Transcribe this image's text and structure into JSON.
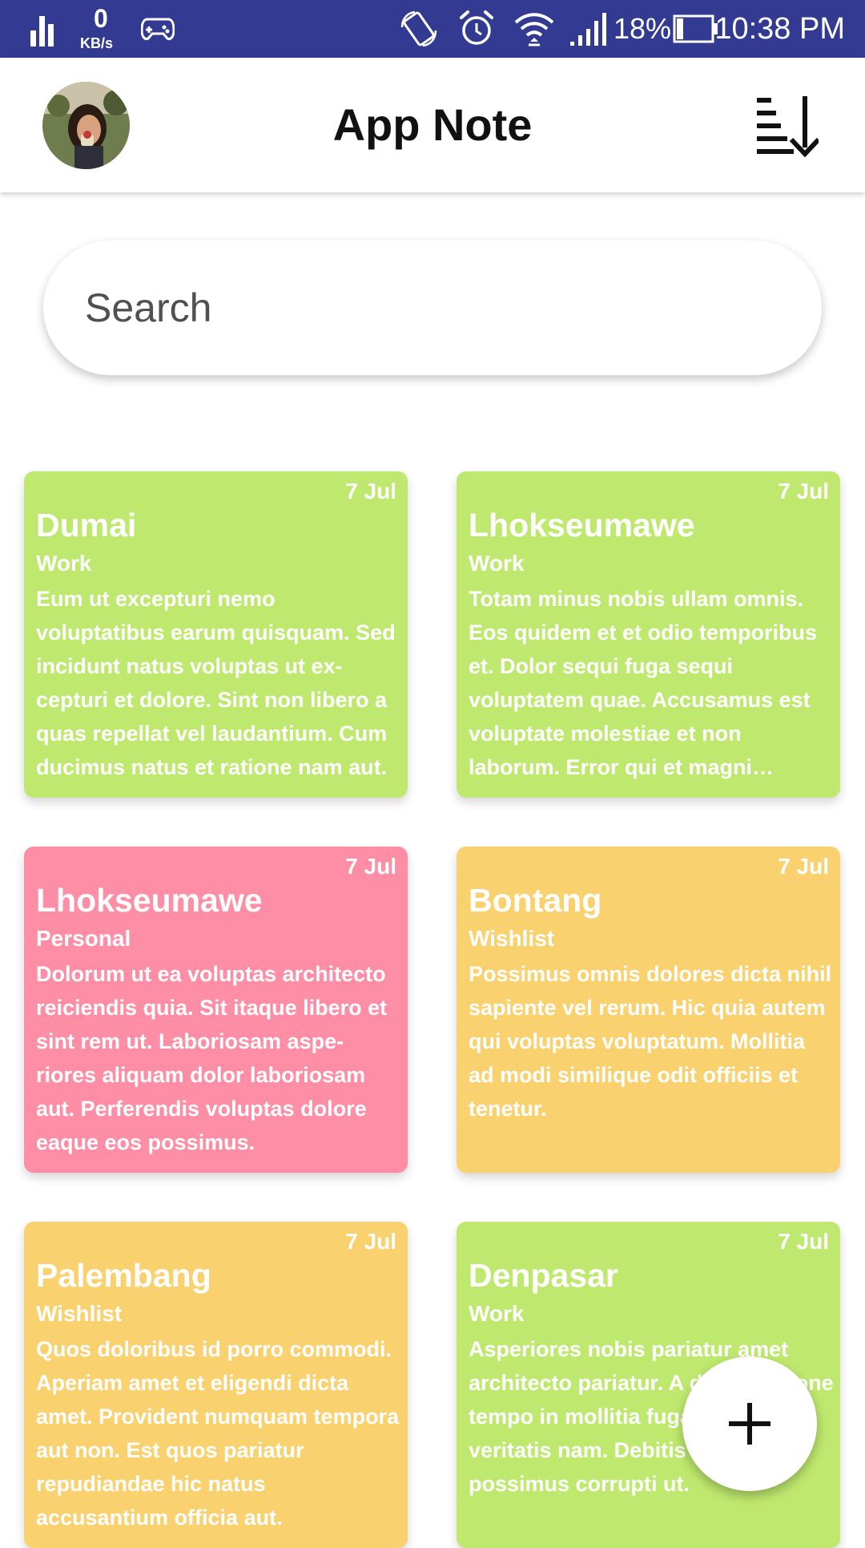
{
  "status_bar": {
    "net_speed_value": "0",
    "net_speed_unit": "KB/s",
    "battery_percent": "18%",
    "time": "10:38 PM"
  },
  "app_bar": {
    "title": "App Note"
  },
  "search": {
    "placeholder": "Search",
    "value": ""
  },
  "colors": {
    "status_bar": "#323b91",
    "work": "#bfe96e",
    "personal": "#fe8ea5",
    "wishlist": "#f9d16f"
  },
  "notes": [
    {
      "date": "7 Jul",
      "title": "Dumai",
      "category": "Work",
      "color": "#bfe96e",
      "body": "Eum ut excepturi nemo voluptatibus earum quisquam. Sed incidunt natus voluptas ut ex-cepturi et dolore. Sint non libero a quas repellat vel laudantium. Cum ducimus natus et ratione nam aut."
    },
    {
      "date": "7 Jul",
      "title": "Lhokseumawe",
      "category": "Work",
      "color": "#bfe96e",
      "body": "Totam minus nobis ullam omnis. Eos quidem et et odio temporibus et. Dolor sequi fuga sequi voluptatem quae. Accusamus est voluptate molestiae et non laborum. Error qui et magni aliquam consequatur."
    },
    {
      "date": "7 Jul",
      "title": "Lhokseumawe",
      "category": "Personal",
      "color": "#fe8ea5",
      "body": "Dolorum ut ea voluptas architecto reiciendis quia. Sit itaque libero et sint rem ut. Laboriosam aspe-riores aliquam dolor laboriosam aut. Perferendis voluptas dolore eaque eos possimus."
    },
    {
      "date": "7 Jul",
      "title": "Bontang",
      "category": "Wishlist",
      "color": "#f9d16f",
      "body": "Possimus omnis dolores dicta nihil sapiente vel rerum. Hic quia autem qui voluptas voluptatum. Mollitia ad modi similique odit officiis et tenetur."
    },
    {
      "date": "7 Jul",
      "title": "Palembang",
      "category": "Wishlist",
      "color": "#f9d16f",
      "body": "Quos doloribus id porro commodi. Aperiam amet et eligendi dicta amet. Provident numquam tempora aut non. Est quos pariatur repudiandae hic natus accusantium officia aut."
    },
    {
      "date": "7 Jul",
      "title": "Denpasar",
      "category": "Work",
      "color": "#bfe96e",
      "body": "Asperiores nobis pariatur amet architecto pariatur. A dolore ratione tempo in mollitia fuga maxi veritatis nam. Debitis blanditiis possimus corrupti ut."
    }
  ]
}
